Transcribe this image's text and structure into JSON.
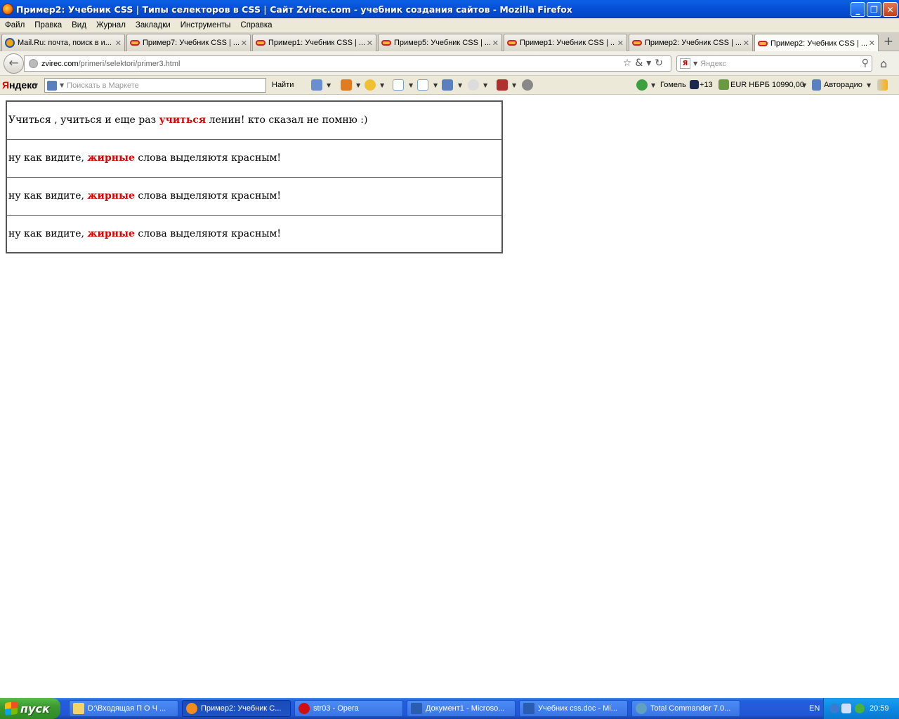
{
  "window": {
    "title": "Пример2: Учебник CSS | Типы селекторов в CSS | Сайт Zvirec.com - учебник создания сайтов - Mozilla Firefox",
    "minimize": "_",
    "maximize": "❐",
    "close": "✕"
  },
  "menubar": {
    "items": [
      "Файл",
      "Правка",
      "Вид",
      "Журнал",
      "Закладки",
      "Инструменты",
      "Справка"
    ]
  },
  "tabs": [
    {
      "label": "Mail.Ru: почта, поиск в и...",
      "icon": "mailru-icon"
    },
    {
      "label": "Пример7: Учебник CSS | ...",
      "icon": "zvirec-icon"
    },
    {
      "label": "Пример1: Учебник CSS | ...",
      "icon": "zvirec-icon"
    },
    {
      "label": "Пример5: Учебник CSS | ...",
      "icon": "zvirec-icon"
    },
    {
      "label": "Пример1: Учебник CSS | ...",
      "icon": "zvirec-icon"
    },
    {
      "label": "Пример2: Учебник CSS | ...",
      "icon": "zvirec-icon"
    },
    {
      "label": "Пример2: Учебник CSS | ...",
      "icon": "zvirec-icon",
      "active": true
    }
  ],
  "tab_close": "✕",
  "new_tab": "+",
  "navbar": {
    "url_host": "zvirec.com",
    "url_path": "/primeri/selektori/primer3.html",
    "search_placeholder": "Яндекс",
    "search_badge": "Я"
  },
  "yandex_bar": {
    "logo_first": "Я",
    "logo_rest": "ндекс",
    "market_placeholder": "Поискать в Маркете",
    "find_label": "Найти",
    "city": "Гомель",
    "temperature": "+13",
    "currency": "EUR НБРБ 10990,00",
    "radio": "Авторадио"
  },
  "page": {
    "rows": [
      {
        "before": "Учиться , учиться и еще раз ",
        "bold": "учиться",
        "after": " ленин! кто сказал не помню :)"
      },
      {
        "before": "ну как видите, ",
        "bold": "жирные",
        "after": " слова выделяютя красным!"
      },
      {
        "before": "ну как видите, ",
        "bold": "жирные",
        "after": " слова выделяютя красным!"
      },
      {
        "before": "ну как видите, ",
        "bold": "жирные",
        "after": " слова выделяютя красным!"
      }
    ],
    "highlight_color": "#e00000"
  },
  "taskbar": {
    "start_label": "пуск",
    "buttons": [
      {
        "label": "D:\\Входящая  П О Ч ...",
        "icon": "folder-icon"
      },
      {
        "label": "Пример2: Учебник C...",
        "icon": "firefox-icon",
        "active": true
      },
      {
        "label": "str03 - Opera",
        "icon": "opera-icon"
      },
      {
        "label": "Документ1 - Microso...",
        "icon": "word-icon"
      },
      {
        "label": "Учебник css.doc - Mi...",
        "icon": "word-icon"
      },
      {
        "label": "Total Commander 7.0...",
        "icon": "total-commander-icon"
      }
    ],
    "language": "EN",
    "clock": "20:59"
  }
}
